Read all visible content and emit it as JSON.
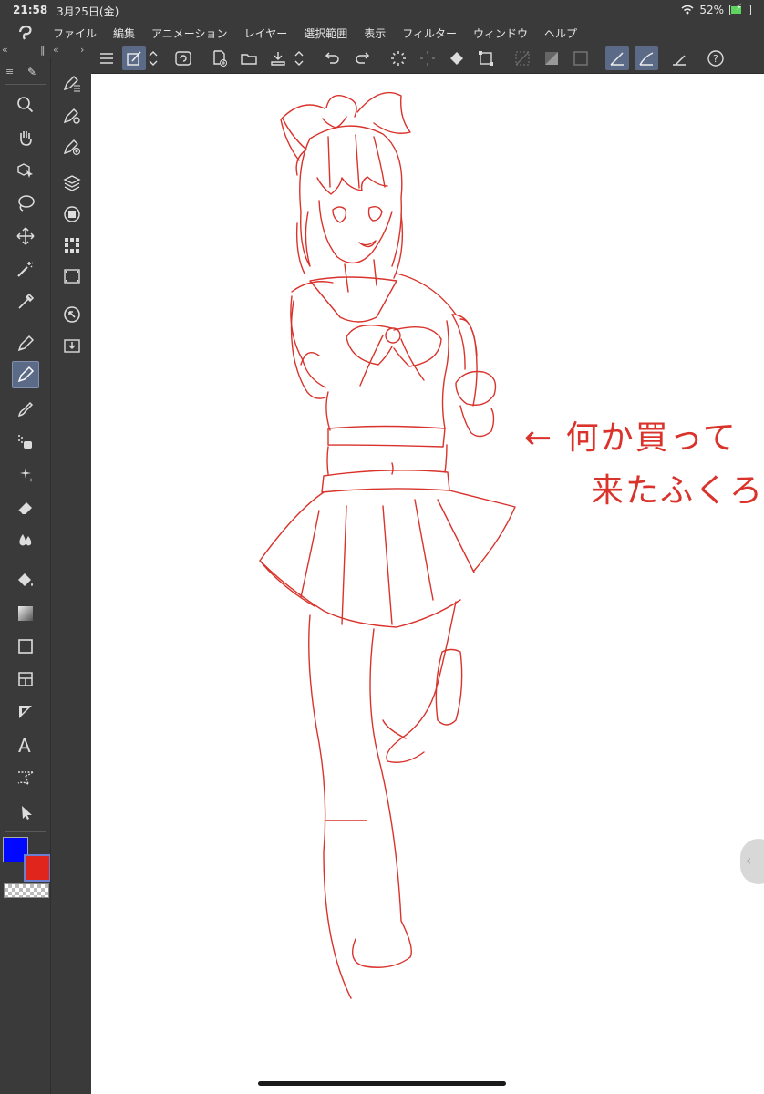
{
  "status": {
    "time": "21:58",
    "date": "3月25日(金)",
    "battery": "52%",
    "battery_level": 0.52
  },
  "menu": {
    "items": [
      "ファイル",
      "編集",
      "アニメーション",
      "レイヤー",
      "選択範囲",
      "表示",
      "フィルター",
      "ウィンドウ",
      "ヘルプ"
    ]
  },
  "canvas": {
    "annotation_line1": "← 何か買って",
    "annotation_line2": "来たふくろ"
  },
  "colors": {
    "main": "#0008ff",
    "sub": "#e0251c",
    "ui_bg": "#3a3a3a",
    "active_tool": "#5b6a86",
    "sketch": "#d9332b"
  },
  "tools": [
    "search-icon",
    "hand-icon",
    "object-select-icon",
    "lasso-icon",
    "move-icon",
    "magic-wand-icon",
    "eyedropper-icon",
    "pen-icon",
    "pencil-icon",
    "brush-icon",
    "airbrush-icon",
    "decoration-icon",
    "eraser-icon",
    "blend-icon",
    "fill-icon",
    "gradient-icon",
    "rectangle-icon",
    "frame-icon",
    "ruler-icon",
    "text-icon",
    "balloon-icon",
    "operation-icon"
  ]
}
